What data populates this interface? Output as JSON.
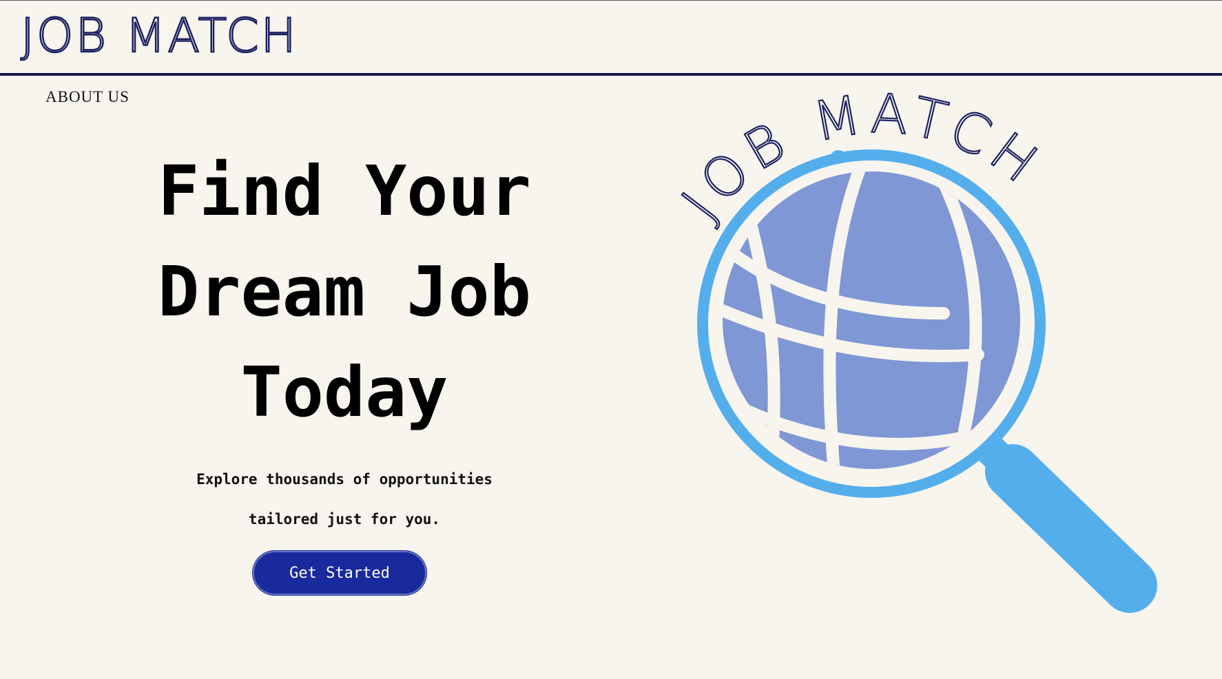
{
  "header": {
    "brand": "JOB MATCH"
  },
  "nav": {
    "about_us": "ABOUT US"
  },
  "hero": {
    "title_line1": "Find Your",
    "title_line2": "Dream Job",
    "title_line3": "Today",
    "subtitle_line1": "Explore thousands of opportunities",
    "subtitle_line2": "tailored just for you.",
    "cta_label": "Get Started"
  },
  "logo": {
    "text": "JOB MATCH",
    "icon": "magnifier-globe-icon"
  },
  "colors": {
    "background": "#f8f5ef",
    "brand_navy": "#1c2260",
    "button_blue": "#182a9c",
    "globe_blue": "#7f97d4",
    "magnifier_blue": "#55aeec"
  }
}
